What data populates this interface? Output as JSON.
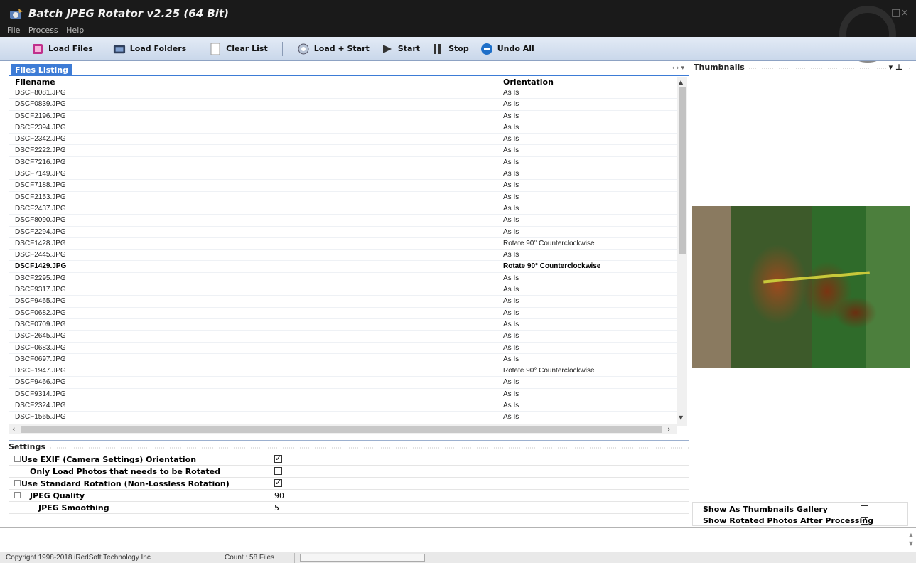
{
  "window": {
    "title": "Batch JPEG Rotator v2.25 (64 Bit)",
    "controls": "□×"
  },
  "menu": [
    "File",
    "Process",
    "Help"
  ],
  "toolbar": {
    "load_files": "Load Files",
    "load_folders": "Load Folders",
    "clear_list": "Clear List",
    "load_start": "Load + Start",
    "start": "Start",
    "stop": "Stop",
    "undo_all": "Undo All"
  },
  "files_panel": {
    "tab": "Files Listing",
    "tab_nav": "‹ › ▾",
    "columns": {
      "filename": "Filename",
      "orientation": "Orientation"
    },
    "rows": [
      {
        "name": "DSCF8081.JPG",
        "orient": "As Is"
      },
      {
        "name": "DSCF0839.JPG",
        "orient": "As Is"
      },
      {
        "name": "DSCF2196.JPG",
        "orient": "As Is"
      },
      {
        "name": "DSCF2394.JPG",
        "orient": "As Is"
      },
      {
        "name": "DSCF2342.JPG",
        "orient": "As Is"
      },
      {
        "name": "DSCF2222.JPG",
        "orient": "As Is"
      },
      {
        "name": "DSCF7216.JPG",
        "orient": "As Is"
      },
      {
        "name": "DSCF7149.JPG",
        "orient": "As Is"
      },
      {
        "name": "DSCF7188.JPG",
        "orient": "As Is"
      },
      {
        "name": "DSCF2153.JPG",
        "orient": "As Is"
      },
      {
        "name": "DSCF2437.JPG",
        "orient": "As Is"
      },
      {
        "name": "DSCF8090.JPG",
        "orient": "As Is"
      },
      {
        "name": "DSCF2294.JPG",
        "orient": "As Is"
      },
      {
        "name": "DSCF1428.JPG",
        "orient": "Rotate 90° Counterclockwise"
      },
      {
        "name": "DSCF2445.JPG",
        "orient": "As Is"
      },
      {
        "name": "DSCF1429.JPG",
        "orient": "Rotate 90° Counterclockwise",
        "selected": true
      },
      {
        "name": "DSCF2295.JPG",
        "orient": "As Is"
      },
      {
        "name": "DSCF9317.JPG",
        "orient": "As Is"
      },
      {
        "name": "DSCF9465.JPG",
        "orient": "As Is"
      },
      {
        "name": "DSCF0682.JPG",
        "orient": "As Is"
      },
      {
        "name": "DSCF0709.JPG",
        "orient": "As Is"
      },
      {
        "name": "DSCF2645.JPG",
        "orient": "As Is"
      },
      {
        "name": "DSCF0683.JPG",
        "orient": "As Is"
      },
      {
        "name": "DSCF0697.JPG",
        "orient": "As Is"
      },
      {
        "name": "DSCF1947.JPG",
        "orient": "Rotate 90° Counterclockwise"
      },
      {
        "name": "DSCF9466.JPG",
        "orient": "As Is"
      },
      {
        "name": "DSCF9314.JPG",
        "orient": "As Is"
      },
      {
        "name": "DSCF2324.JPG",
        "orient": "As Is"
      },
      {
        "name": "DSCF1565.JPG",
        "orient": "As Is"
      }
    ]
  },
  "settings": {
    "title": "Settings",
    "items": [
      {
        "label": "Use EXIF (Camera Settings) Orientation",
        "checked": true,
        "expander": "−"
      },
      {
        "label": "Only Load Photos that needs to be Rotated",
        "checked": false
      },
      {
        "label": "Use Standard Rotation (Non-Lossless Rotation)",
        "checked": true,
        "expander": "−"
      },
      {
        "label": "JPEG Quality",
        "value": "90",
        "expander": "−"
      },
      {
        "label": "JPEG Smoothing",
        "value": "5"
      }
    ]
  },
  "thumbnails": {
    "title": "Thumbnails",
    "pin": "▾ ⊥",
    "show_gallery": "Show As Thumbnails Gallery",
    "show_gallery_checked": false,
    "show_rotated": "Show Rotated Photos After Processing",
    "show_rotated_checked": true
  },
  "status": {
    "copyright": "Copyright 1998-2018 iRedSoft Technology Inc",
    "count": "Count : 58 Files"
  }
}
